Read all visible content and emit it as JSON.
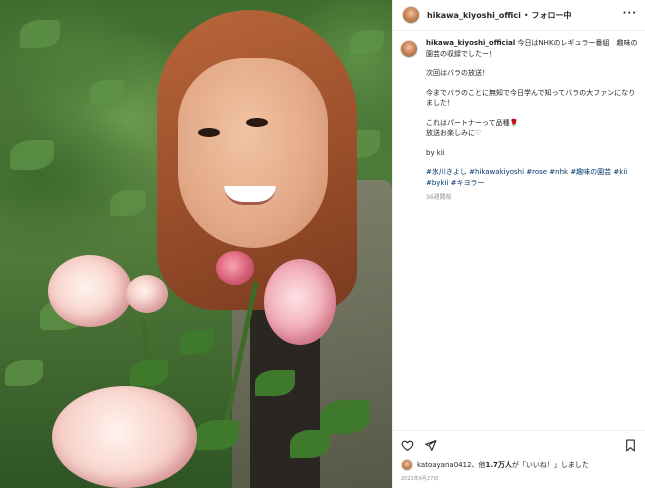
{
  "post": {
    "username": "hikawa_kiyoshi_offici",
    "separator": "•",
    "follow_state": "フォロー中",
    "more_glyph": "···"
  },
  "caption": {
    "username": "hikawa_kiyoshi_official",
    "line1": " 今日はNHKのレギュラー番組　趣味の園芸の収録でしたー！",
    "line2": "次回はバラの放送！",
    "line3": "今までバラのことに無知で今日学んで知ってバラの大ファンになりました！",
    "line4": "これはパートナーって品種🌹\n放送お楽しみに♡",
    "line5": "by kii",
    "hashtags": "#氷川きよし #hikawakiyoshi #rose #nhk #趣味の園芸 #kii #bykii #キヨラー",
    "time_ago": "36週間前"
  },
  "actions": {
    "like_icon": "heart-icon",
    "share_icon": "send-icon",
    "save_icon": "bookmark-icon"
  },
  "likes": {
    "user": "katoayana0412",
    "text_mid": "、他",
    "count": "1.7万人",
    "text_end": "が「いいね！」しました"
  },
  "date": "2021年4月27日",
  "colors": {
    "text": "#262626",
    "muted": "#8e8e8e",
    "hashtag": "#00376b",
    "border": "#efefef"
  }
}
